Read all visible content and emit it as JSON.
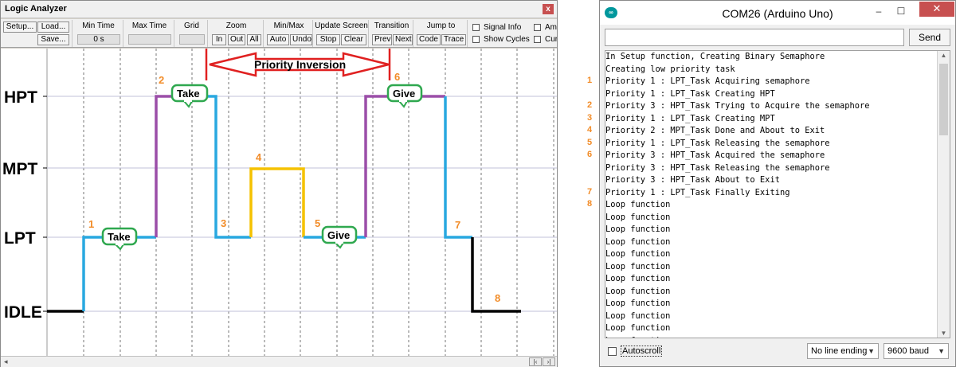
{
  "logic_analyzer": {
    "title": "Logic Analyzer",
    "close_label": "x",
    "toolbar": {
      "setup_label": "Setup...",
      "load_label": "Load...",
      "save_label": "Save...",
      "min_time_label": "Min Time",
      "min_time_value": "0 s",
      "max_time_label": "Max Time",
      "grid_label": "Grid",
      "zoom_label": "Zoom",
      "zoom_in": "In",
      "zoom_out": "Out",
      "zoom_all": "All",
      "minmax_label": "Min/Max",
      "auto_label": "Auto",
      "undo_label": "Undo",
      "update_label": "Update Screen",
      "stop_label": "Stop",
      "clear_label": "Clear",
      "transition_label": "Transition",
      "prev_label": "Prev",
      "next_label": "Next",
      "jump_label": "Jump to",
      "code_label": "Code",
      "trace_label": "Trace",
      "signal_info_label": "Signal Info",
      "show_cycles_label": "Show Cycles",
      "amp_label": "Amp",
      "cur_label": "Cur"
    },
    "levels": [
      "HPT",
      "MPT",
      "LPT",
      "IDLE"
    ],
    "annotations": {
      "priority_inversion": "Priority Inversion",
      "take": "Take",
      "give": "Give"
    },
    "markers": [
      "1",
      "2",
      "3",
      "4",
      "5",
      "6",
      "7",
      "8"
    ],
    "colors": {
      "lpt": "#29a8e0",
      "hpt": "#9b4ea8",
      "mpt": "#f5c200",
      "idle": "#000000",
      "arrow": "#e02020",
      "bubble_border": "#2fa84f",
      "marker": "#f28c28"
    }
  },
  "serial_monitor": {
    "title": "COM26 (Arduino Uno)",
    "send_label": "Send",
    "input_value": "",
    "lines": [
      {
        "marker": "",
        "text": "In Setup function, Creating Binary Semaphore"
      },
      {
        "marker": "",
        "text": "Creating low priority task"
      },
      {
        "marker": "1",
        "text": "Priority 1 : LPT_Task Acquiring semaphore"
      },
      {
        "marker": "",
        "text": "Priority 1 : LPT_Task Creating HPT"
      },
      {
        "marker": "2",
        "text": "Priority 3 : HPT_Task Trying to Acquire the semaphore"
      },
      {
        "marker": "3",
        "text": "Priority 1 : LPT_Task Creating MPT"
      },
      {
        "marker": "4",
        "text": "Priority 2 : MPT_Task Done and About to Exit"
      },
      {
        "marker": "5",
        "text": "Priority 1 : LPT_Task Releasing the semaphore"
      },
      {
        "marker": "6",
        "text": "Priority 3 : HPT_Task Acquired the semaphore"
      },
      {
        "marker": "",
        "text": "Priority 3 : HPT_Task Releasing the semaphore"
      },
      {
        "marker": "",
        "text": "Priority 3 : HPT_Task About to Exit"
      },
      {
        "marker": "7",
        "text": "Priority 1 : LPT_Task Finally Exiting"
      },
      {
        "marker": "8",
        "text": "Loop function"
      },
      {
        "marker": "",
        "text": "Loop function"
      },
      {
        "marker": "",
        "text": "Loop function"
      },
      {
        "marker": "",
        "text": "Loop function"
      },
      {
        "marker": "",
        "text": "Loop function"
      },
      {
        "marker": "",
        "text": "Loop function"
      },
      {
        "marker": "",
        "text": "Loop function"
      },
      {
        "marker": "",
        "text": "Loop function"
      },
      {
        "marker": "",
        "text": "Loop function"
      },
      {
        "marker": "",
        "text": "Loop function"
      },
      {
        "marker": "",
        "text": "Loop function"
      },
      {
        "marker": "",
        "text": "Loop function"
      },
      {
        "marker": "",
        "text": "Loop function"
      }
    ],
    "autoscroll_label": "Autoscroll",
    "line_ending_value": "No line ending",
    "baud_value": "9600 baud"
  }
}
